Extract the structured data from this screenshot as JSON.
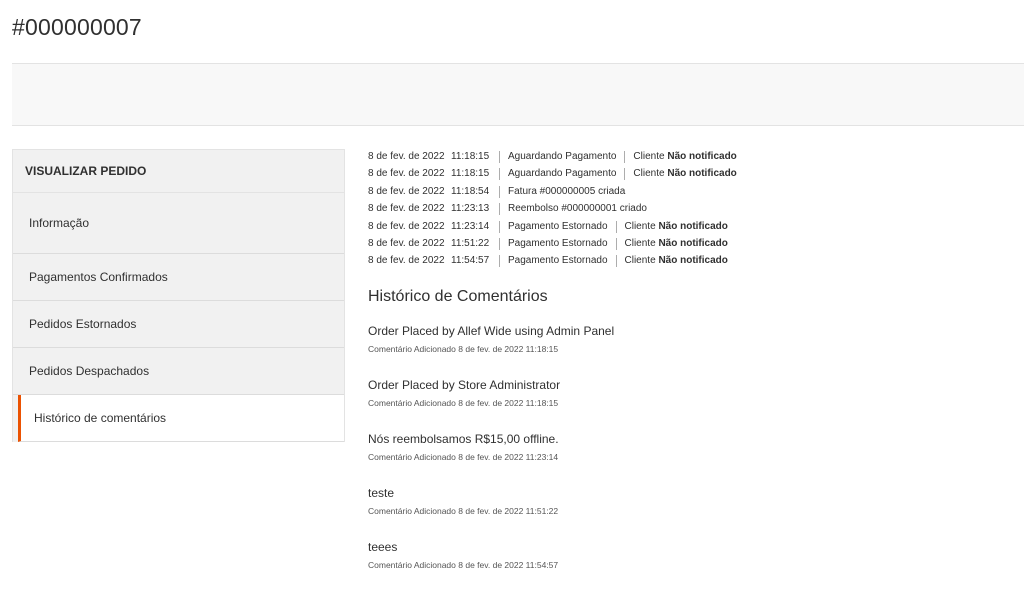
{
  "header": {
    "title": "#000000007"
  },
  "side_nav": {
    "title": "VISUALIZAR PEDIDO",
    "items": [
      {
        "label": "Informação"
      },
      {
        "label": "Pagamentos Confirmados"
      },
      {
        "label": "Pedidos Estornados"
      },
      {
        "label": "Pedidos Despachados"
      },
      {
        "label": "Histórico de comentários"
      }
    ],
    "active_index": 4,
    "accent_color": "#eb5202"
  },
  "history": [
    {
      "date": "8 de fev. de 2022",
      "time": "11:18:15",
      "status": "Aguardando Pagamento",
      "customer": "Cliente",
      "notified": "Não notificado"
    },
    {
      "date": "8 de fev. de 2022",
      "time": "11:18:15",
      "status": "Aguardando Pagamento",
      "customer": "Cliente",
      "notified": "Não notificado"
    },
    {
      "date": "8 de fev. de 2022",
      "time": "11:18:54",
      "status": "Fatura #000000005 criada",
      "customer": "",
      "notified": ""
    },
    {
      "date": "8 de fev. de 2022",
      "time": "11:23:13",
      "status": "Reembolso #000000001 criado",
      "customer": "",
      "notified": ""
    },
    {
      "date": "8 de fev. de 2022",
      "time": "11:23:14",
      "status": "Pagamento Estornado",
      "customer": "Cliente",
      "notified": "Não notificado"
    },
    {
      "date": "8 de fev. de 2022",
      "time": "11:51:22",
      "status": "Pagamento Estornado",
      "customer": "Cliente",
      "notified": "Não notificado"
    },
    {
      "date": "8 de fev. de 2022",
      "time": "11:54:57",
      "status": "Pagamento Estornado",
      "customer": "Cliente",
      "notified": "Não notificado"
    }
  ],
  "comments_section": {
    "title": "Histórico de Comentários",
    "comments": [
      {
        "text": "Order Placed by Allef Wide using Admin Panel",
        "meta": "Comentário Adicionado 8 de fev. de 2022 11:18:15"
      },
      {
        "text": "Order Placed by Store Administrator",
        "meta": "Comentário Adicionado 8 de fev. de 2022 11:18:15"
      },
      {
        "text": "Nós reembolsamos R$15,00 offline.",
        "meta": "Comentário Adicionado 8 de fev. de 2022 11:23:14"
      },
      {
        "text": "teste",
        "meta": "Comentário Adicionado 8 de fev. de 2022 11:51:22"
      },
      {
        "text": "teees",
        "meta": "Comentário Adicionado 8 de fev. de 2022 11:54:57"
      }
    ]
  }
}
